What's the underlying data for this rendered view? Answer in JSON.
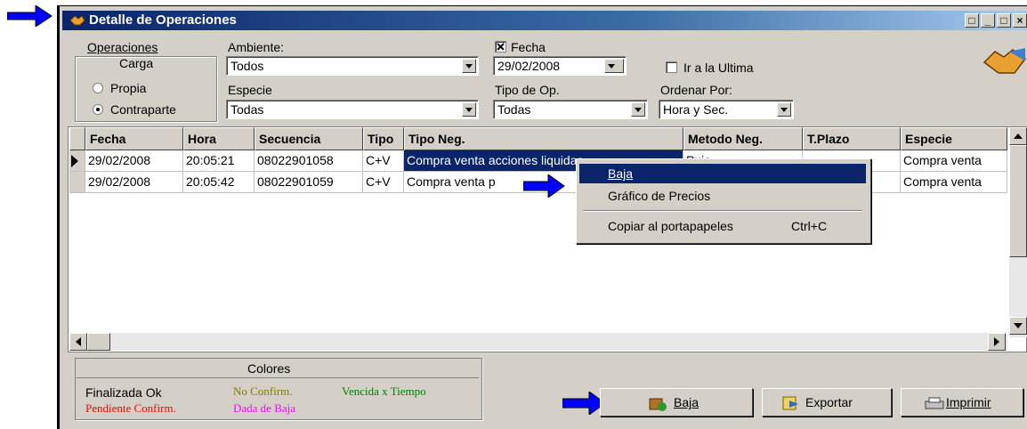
{
  "window": {
    "title": "Detalle de Operaciones"
  },
  "filters": {
    "operaciones_group": {
      "title_line1": "Operaciones",
      "title_line2": "Carga",
      "opt_propia": "Propia",
      "opt_contraparte": "Contraparte",
      "selected": "Contraparte"
    },
    "ambiente": {
      "label": "Ambiente:",
      "value": "Todos"
    },
    "especie": {
      "label": "Especie",
      "value": "Todas"
    },
    "fecha": {
      "label": "Fecha",
      "checked": true,
      "value": "29/02/2008"
    },
    "tipo_op": {
      "label": "Tipo de Op.",
      "value": "Todas"
    },
    "ir_ultima": {
      "label": "Ir a la Ultima",
      "checked": false
    },
    "ordenar": {
      "label": "Ordenar Por:",
      "value": "Hora y Sec."
    }
  },
  "table": {
    "columns": [
      "Fecha",
      "Hora",
      "Secuencia",
      "Tipo",
      "Tipo Neg.",
      "Metodo Neg.",
      "T.Plazo",
      "Especie"
    ],
    "rows": [
      {
        "fecha": "29/02/2008",
        "hora": "20:05:21",
        "secuencia": "08022901058",
        "tipo": "C+V",
        "tipo_neg": "Compra venta acciones liquidas",
        "metodo": "Pujo",
        "plazo": "",
        "especie": "Compra venta"
      },
      {
        "fecha": "29/02/2008",
        "hora": "20:05:42",
        "secuencia": "08022901059",
        "tipo": "C+V",
        "tipo_neg": "Compra venta p",
        "metodo": "",
        "plazo": "",
        "especie": "Compra venta"
      }
    ]
  },
  "context_menu": {
    "items": [
      {
        "label": "Baja",
        "shortcut": "",
        "highlighted": true
      },
      {
        "label": "Gráfico de Precios",
        "shortcut": ""
      },
      {
        "label": "Copiar al portapapeles",
        "shortcut": "Ctrl+C"
      }
    ]
  },
  "legend": {
    "title": "Colores",
    "finalizada": "Finalizada Ok",
    "no_confirm": "No Confirm.",
    "vencida": "Vencida x Tiempo",
    "pendiente": "Pendiente Confirm.",
    "dada_baja": "Dada de Baja",
    "colors": {
      "finalizada": "#000000",
      "no_confirm": "#808000",
      "vencida": "#008000",
      "pendiente": "#ff0000",
      "dada_baja": "#ff00ff"
    }
  },
  "buttons": {
    "baja": "Baja",
    "exportar": "Exportar",
    "imprimir": "Imprimir"
  },
  "accent": {
    "arrow": "#0000ff",
    "selection": "#0a246a"
  }
}
